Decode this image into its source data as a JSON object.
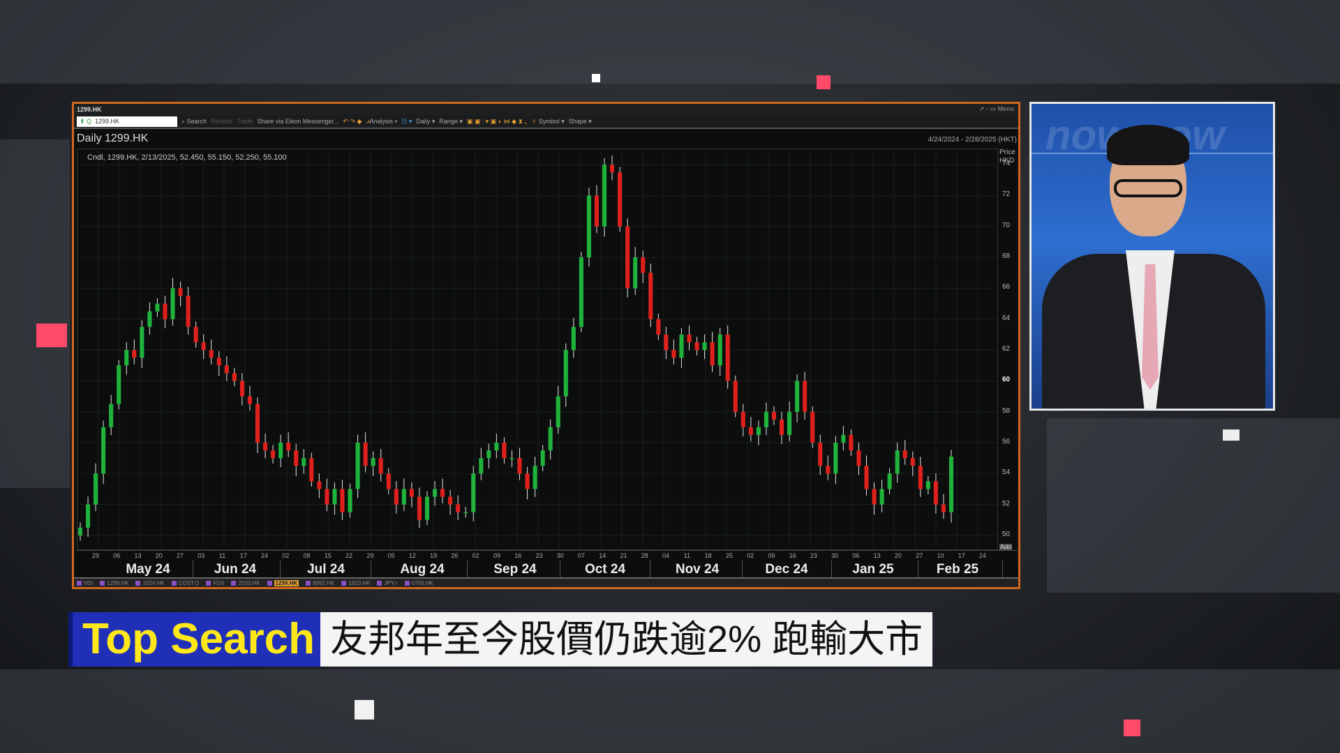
{
  "window": {
    "title": "1299.HK",
    "controls": "Menu"
  },
  "toolbar": {
    "symbol_value": "1299.HK",
    "items": [
      "Search",
      "Related",
      "Trade",
      "Share via Eikon Messenger...",
      "Analysis",
      "Daily",
      "Range",
      "Symbol",
      "Shape"
    ]
  },
  "chart_header": {
    "title": "Daily 1299.HK",
    "range": "4/24/2024 - 2/28/2025 (HKT)",
    "legend": "Cndl, 1299.HK, 2/13/2025, 52.450, 55.150, 52.250, 55.100",
    "price_label": "Price",
    "currency_label": "HKD",
    "auto_label": "Auto"
  },
  "chart_data": {
    "type": "candlestick",
    "title": "Daily 1299.HK",
    "ylabel": "Price HKD",
    "ylim": [
      49,
      75
    ],
    "y_ticks": [
      50,
      52,
      54,
      56,
      58,
      60,
      62,
      64,
      66,
      68,
      70,
      72,
      74
    ],
    "x_day_ticks": [
      "29",
      "06",
      "13",
      "20",
      "27",
      "03",
      "11",
      "17",
      "24",
      "02",
      "08",
      "15",
      "22",
      "29",
      "05",
      "12",
      "19",
      "26",
      "02",
      "09",
      "16",
      "23",
      "30",
      "07",
      "14",
      "21",
      "28",
      "04",
      "11",
      "18",
      "25",
      "02",
      "09",
      "16",
      "23",
      "30",
      "06",
      "13",
      "20",
      "27",
      "10",
      "17",
      "24"
    ],
    "x_months": [
      "May 24",
      "Jun 24",
      "Jul 24",
      "Aug 24",
      "Sep 24",
      "Oct 24",
      "Nov 24",
      "Dec 24",
      "Jan 25",
      "Feb 25"
    ],
    "colors": {
      "up": "#1fb33c",
      "down": "#e0201c",
      "wick": "#e8e8e8"
    },
    "close": [
      50.5,
      52,
      54,
      57,
      58.5,
      61,
      62,
      61.5,
      63.5,
      64.5,
      65,
      64,
      66,
      65.5,
      63.5,
      62.5,
      62,
      61.5,
      61,
      60.5,
      60,
      59,
      58.5,
      56,
      55.5,
      55,
      56,
      55.5,
      54.5,
      55,
      53.5,
      53,
      52,
      53,
      51.5,
      53,
      56,
      54.5,
      55,
      54,
      53,
      52,
      53,
      52.5,
      51,
      52.5,
      53,
      52.5,
      52,
      51.5,
      51.5,
      54,
      55,
      55.5,
      56,
      55,
      55,
      54,
      53,
      54.5,
      55.5,
      57,
      59,
      62,
      63.5,
      68,
      72,
      70,
      74,
      73.5,
      70,
      66,
      68,
      67,
      64,
      63,
      62,
      61.5,
      63,
      62.5,
      62,
      62.5,
      61,
      63,
      60,
      58,
      57,
      56.5,
      57,
      58,
      57.5,
      56.5,
      58,
      60,
      58,
      56,
      54.5,
      54,
      56,
      56.5,
      55.5,
      54.5,
      53,
      52,
      53,
      54,
      55.5,
      55,
      54.5,
      53,
      53.5,
      52,
      51.5,
      55.1
    ]
  },
  "symbol_tabs": [
    {
      "label": "HSI"
    },
    {
      "label": "1299.HK"
    },
    {
      "label": "1024.HK"
    },
    {
      "label": "COST.O"
    },
    {
      "label": "FDX"
    },
    {
      "label": "2533.HK"
    },
    {
      "label": "1299.HK",
      "active": true
    },
    {
      "label": "9992.HK"
    },
    {
      "label": "1810.HK"
    },
    {
      "label": "JPY="
    },
    {
      "label": "0700.HK"
    }
  ],
  "banner": {
    "tag": "Top Search",
    "headline": "友邦年至今股價仍跌逾2% 跑輸大市"
  },
  "video": {
    "brand_text": "now"
  }
}
